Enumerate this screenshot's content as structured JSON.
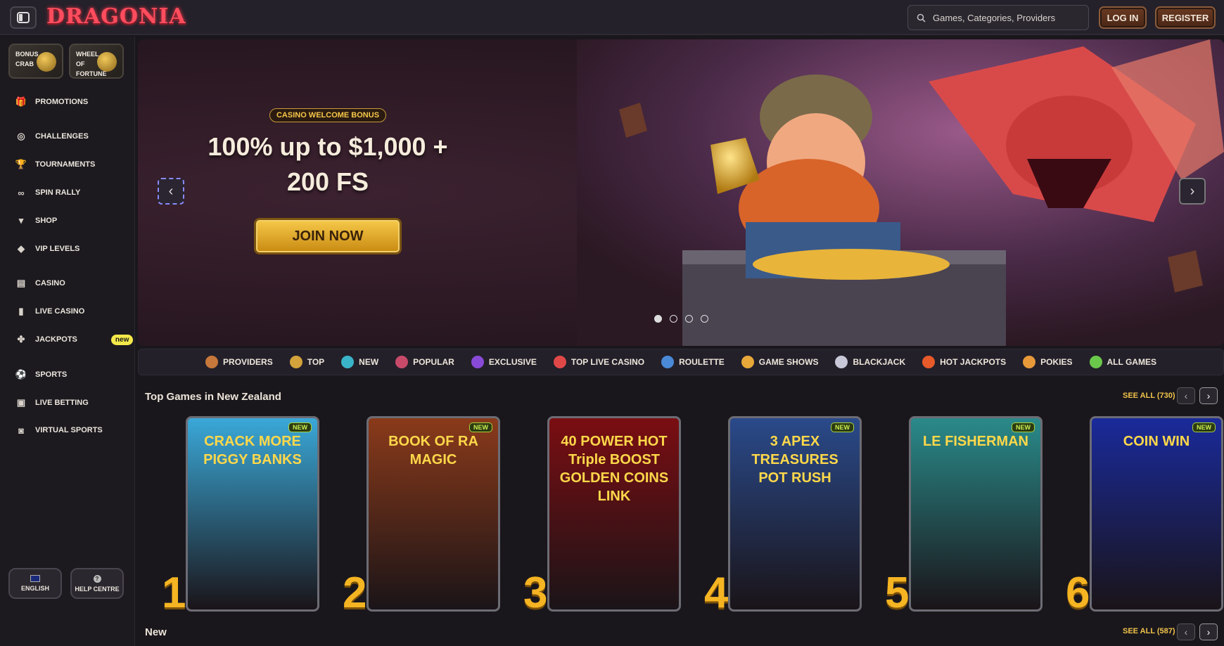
{
  "header": {
    "logo": "DRAGONIA",
    "search_placeholder": "Games, Categories, Providers",
    "login": "LOG IN",
    "register": "REGISTER"
  },
  "sidebar": {
    "tiles": [
      {
        "label": "BONUS CRAB"
      },
      {
        "label": "WHEEL OF FORTUNE"
      }
    ],
    "items": [
      {
        "label": "PROMOTIONS",
        "icon": "gift-icon"
      },
      {
        "label": "CHALLENGES",
        "icon": "target-icon"
      },
      {
        "label": "TOURNAMENTS",
        "icon": "trophy-icon"
      },
      {
        "label": "SPIN RALLY",
        "icon": "bike-icon"
      },
      {
        "label": "SHOP",
        "icon": "basket-icon"
      },
      {
        "label": "VIP LEVELS",
        "icon": "diamond-icon"
      },
      {
        "label": "CASINO",
        "icon": "slot-icon"
      },
      {
        "label": "LIVE CASINO",
        "icon": "card-icon"
      },
      {
        "label": "JACKPOTS",
        "icon": "clover-icon",
        "badge": "new"
      },
      {
        "label": "SPORTS",
        "icon": "ball-icon"
      },
      {
        "label": "LIVE BETTING",
        "icon": "live-icon"
      },
      {
        "label": "VIRTUAL SPORTS",
        "icon": "vr-icon"
      }
    ],
    "language": "ENGLISH",
    "help": "HELP CENTRE"
  },
  "hero": {
    "chip": "CASINO WELCOME BONUS",
    "headline_1": "100% up to $1,000 +",
    "headline_2": "200 FS",
    "cta": "JOIN NOW",
    "slides": 4,
    "active_slide": 1
  },
  "categories": [
    {
      "label": "PROVIDERS",
      "color": "#c8783a"
    },
    {
      "label": "TOP",
      "color": "#d4a23a"
    },
    {
      "label": "NEW",
      "color": "#3ab4c8"
    },
    {
      "label": "POPULAR",
      "color": "#c84a6a"
    },
    {
      "label": "EXCLUSIVE",
      "color": "#8a4ad8"
    },
    {
      "label": "TOP LIVE CASINO",
      "color": "#e04848"
    },
    {
      "label": "ROULETTE",
      "color": "#4a8ad8"
    },
    {
      "label": "GAME SHOWS",
      "color": "#e8a83a"
    },
    {
      "label": "BLACKJACK",
      "color": "#c8c8d8"
    },
    {
      "label": "HOT JACKPOTS",
      "color": "#e85a2a"
    },
    {
      "label": "POKIES",
      "color": "#e89a3a"
    },
    {
      "label": "ALL GAMES",
      "color": "#6ac84a"
    }
  ],
  "top_games": {
    "title": "Top Games in New Zealand",
    "see_all": "SEE ALL (730)",
    "games": [
      {
        "rank": "1",
        "title": "CRACK MORE PIGGY BANKS",
        "badge": "NEW",
        "bg": "#3aa8d8"
      },
      {
        "rank": "2",
        "title": "BOOK OF RA MAGIC",
        "badge": "NEW",
        "bg": "#8a3a1a"
      },
      {
        "rank": "3",
        "title": "40 POWER HOT Triple BOOST GOLDEN COINS LINK",
        "badge": "",
        "bg": "#7a0e12"
      },
      {
        "rank": "4",
        "title": "3 APEX TREASURES POT RUSH",
        "badge": "NEW",
        "bg": "#2a4a8a"
      },
      {
        "rank": "5",
        "title": "LE FISHERMAN",
        "badge": "NEW",
        "bg": "#2a8a8a"
      },
      {
        "rank": "6",
        "title": "COIN WIN",
        "badge": "NEW",
        "bg": "#1a2a9a"
      }
    ]
  },
  "new_section": {
    "title": "New",
    "see_all": "SEE ALL (587)"
  }
}
